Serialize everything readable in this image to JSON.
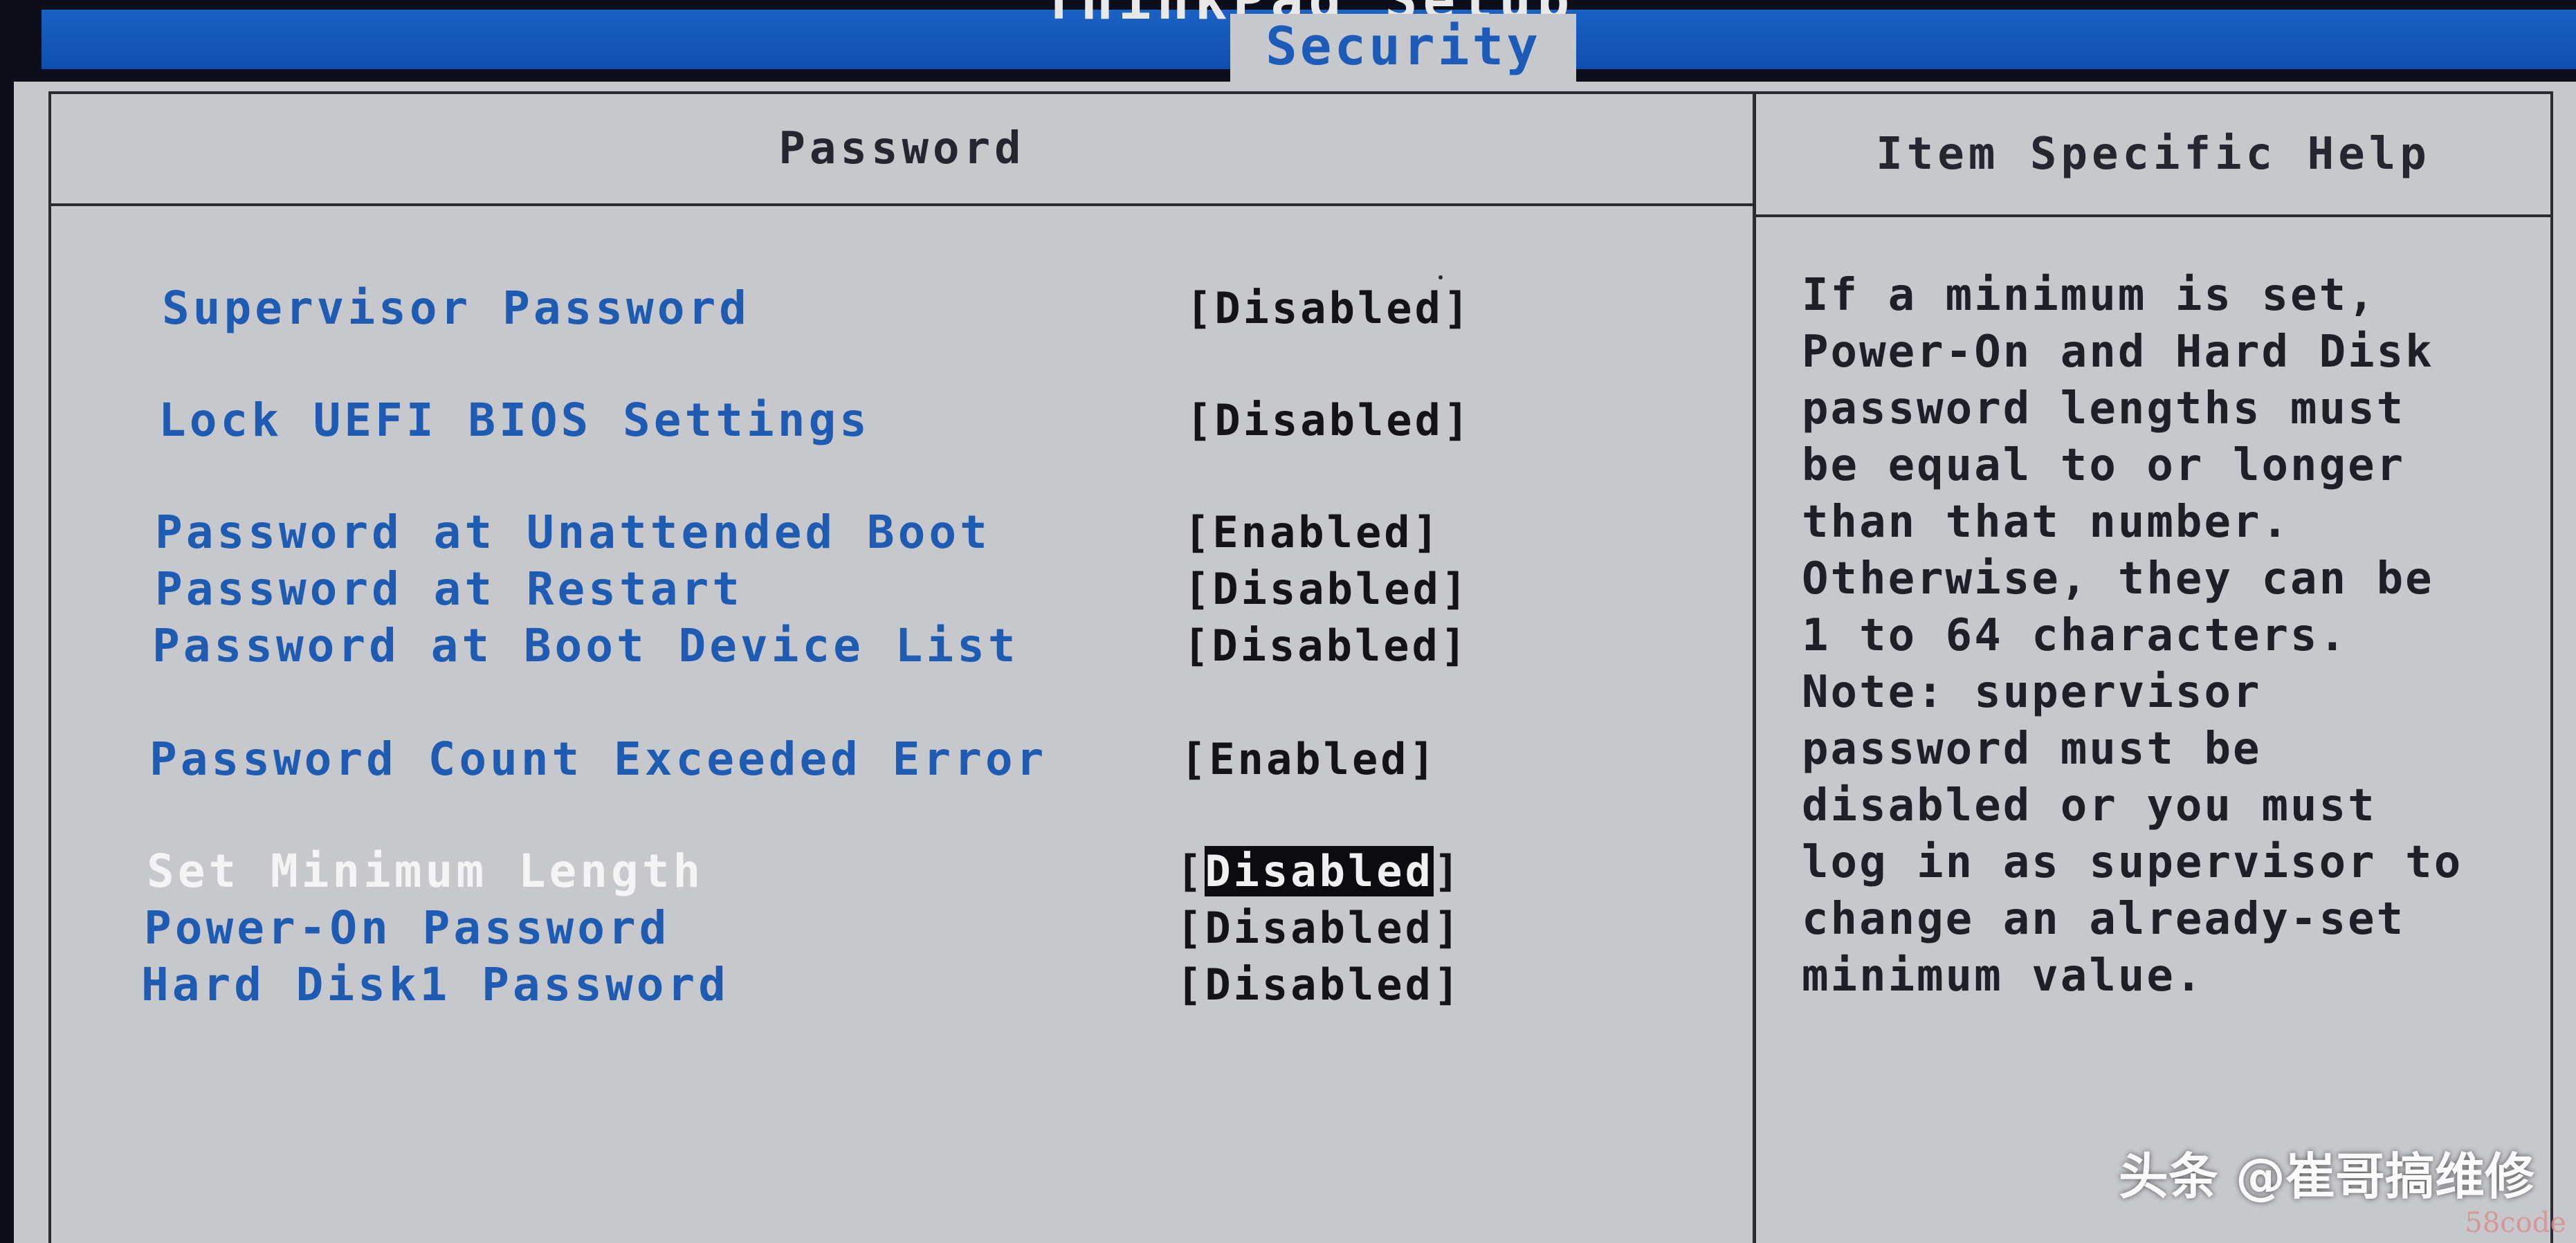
{
  "window": {
    "setup_title": "ThinkPad Setup",
    "active_tab": "Security"
  },
  "left_panel": {
    "title": "Password",
    "items": [
      {
        "label": "Supervisor Password",
        "value": "[Disabled]"
      },
      {
        "label": "Lock UEFI BIOS Settings",
        "value": "[Disabled]"
      },
      {
        "label": "Password at Unattended Boot",
        "value": "[Enabled]"
      },
      {
        "label": "Password at Restart",
        "value": "[Disabled]"
      },
      {
        "label": "Password at Boot Device List",
        "value": "[Disabled]"
      },
      {
        "label": "Password Count Exceeded Error",
        "value": "[Enabled]"
      },
      {
        "label": "Set Minimum Length",
        "value": "Disabled",
        "value_open": "[",
        "value_close": "]",
        "selected": true
      },
      {
        "label": "Power-On Password",
        "value": "[Disabled]"
      },
      {
        "label": "Hard Disk1 Password",
        "value": "[Disabled]"
      }
    ]
  },
  "help_panel": {
    "title": "Item Specific Help",
    "text": "If a minimum is set, Power-On and Hard Disk password lengths must be equal to or longer than that number. Otherwise, they can be 1 to 64 characters. Note: supervisor password must be disabled or you must log in as supervisor to change an already-set minimum value."
  },
  "overlay": {
    "watermark": "头条 @崔哥搞维修",
    "corner_mark": "58code"
  },
  "colors": {
    "screen_bg": "#c6c8cc",
    "label_blue": "#1e5bb2",
    "header_blue": "#0d4fb0",
    "selected_label": "#f4f4f4",
    "value_text": "#141418",
    "highlight_bg": "#0c0c10"
  }
}
